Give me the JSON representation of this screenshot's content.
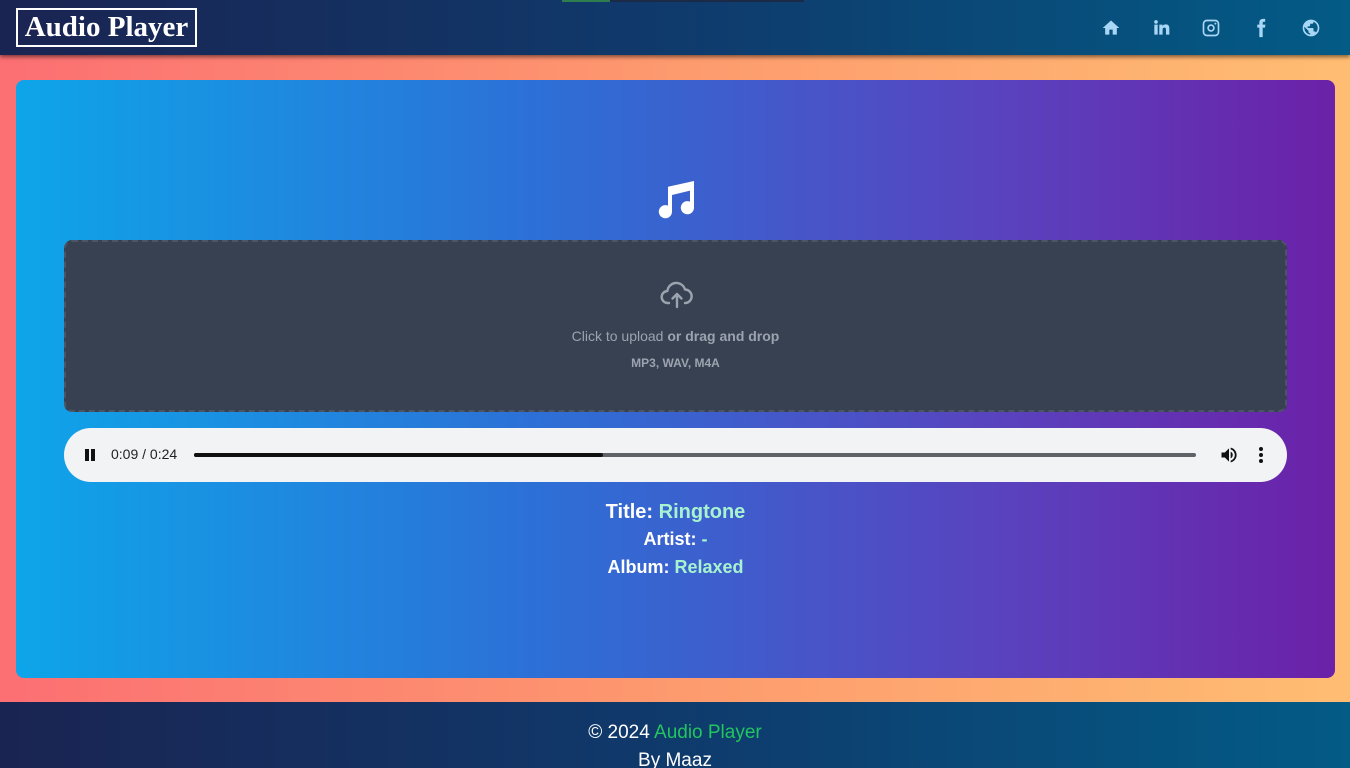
{
  "header": {
    "brand": "Audio Player",
    "nav": [
      {
        "name": "home-icon"
      },
      {
        "name": "linkedin-icon"
      },
      {
        "name": "instagram-icon"
      },
      {
        "name": "facebook-icon"
      },
      {
        "name": "globe-icon"
      }
    ]
  },
  "main": {
    "icon": "music-note-icon",
    "dropzone": {
      "icon": "cloud-upload-icon",
      "click_text": "Click to upload",
      "drag_text": "or drag and drop",
      "formats": "MP3, WAV, M4A"
    },
    "player": {
      "current_time": "0:09",
      "duration": "0:24",
      "time_display": "0:09 / 0:24",
      "progress": 0.408,
      "state": "playing"
    },
    "metadata": {
      "title_label": "Title:",
      "title_value": "Ringtone",
      "artist_label": "Artist:",
      "artist_value": "-",
      "album_label": "Album:",
      "album_value": "Relaxed"
    }
  },
  "footer": {
    "copyright": "© 2024",
    "brand": "Audio Player",
    "byline": "By Maaz"
  },
  "colors": {
    "accent_green": "#22c55e",
    "meta_value": "#a7f3d0",
    "dropzone_bg": "#374151"
  }
}
